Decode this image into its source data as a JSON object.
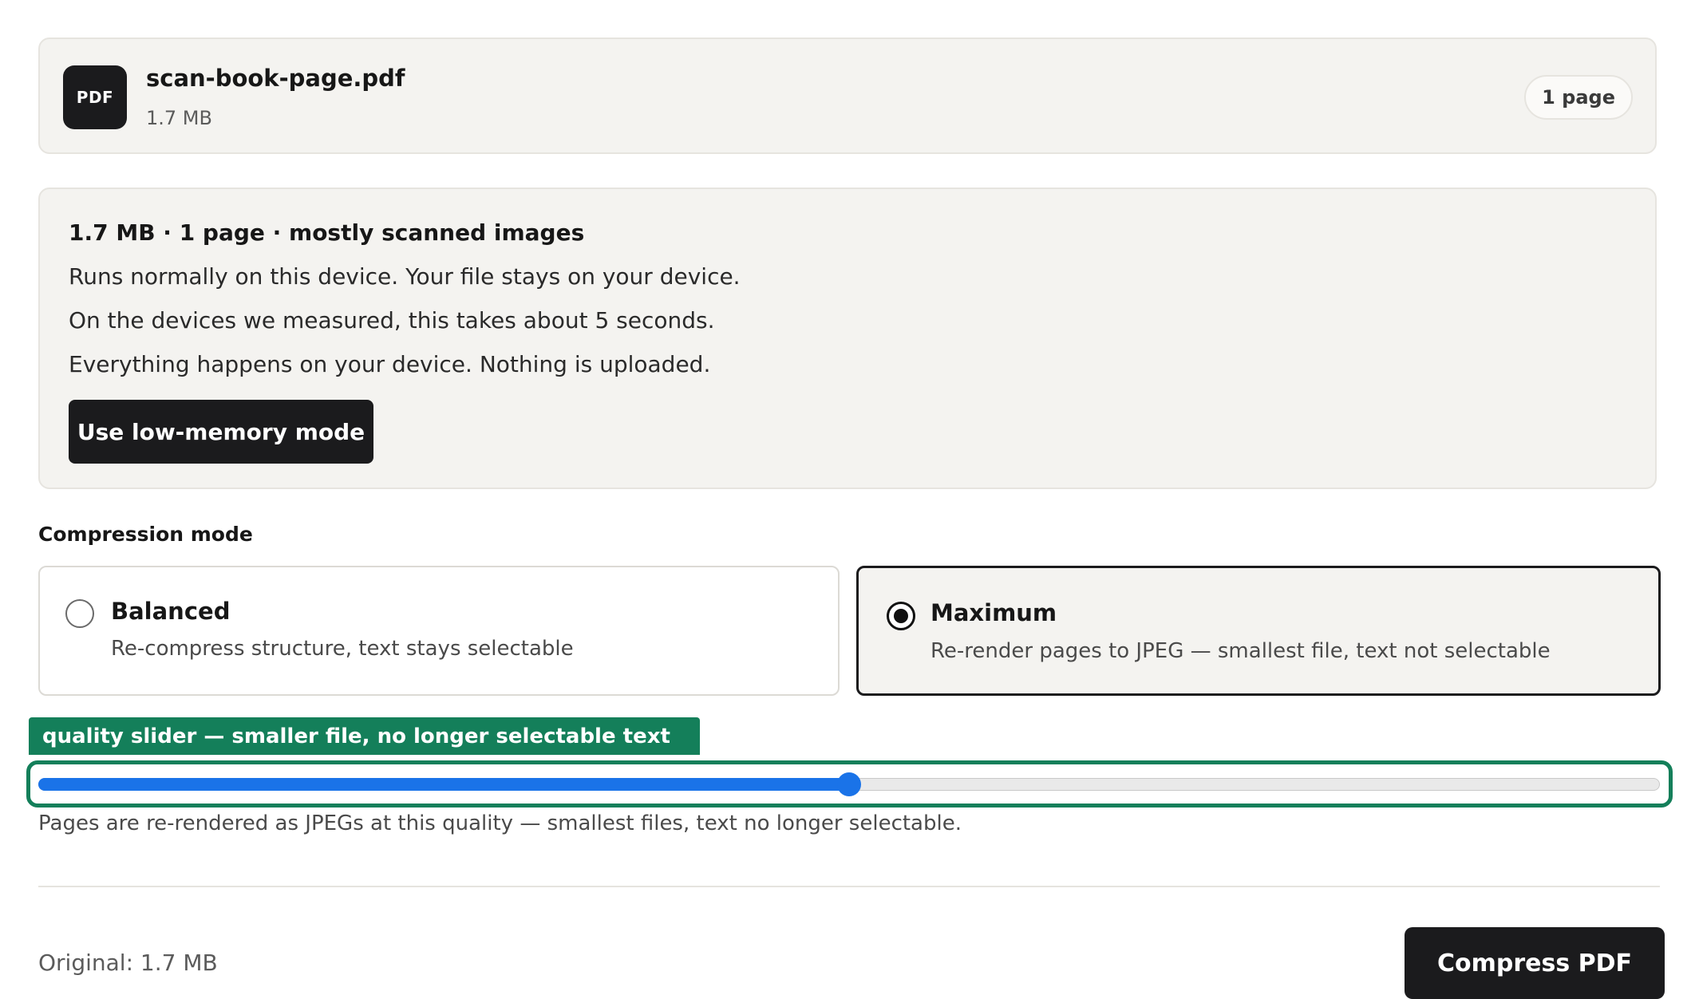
{
  "file": {
    "icon_label": "PDF",
    "name": "scan-book-page.pdf",
    "size": "1.7 MB",
    "pages_badge": "1 page"
  },
  "info": {
    "summary": "1.7 MB · 1 page · mostly scanned images",
    "lines": [
      "Runs normally on this device. Your file stays on your device.",
      "On the devices we measured, this takes about 5 seconds.",
      "Everything happens on your device. Nothing is uploaded."
    ],
    "lowmem_button": "Use low-memory mode"
  },
  "compression": {
    "label": "Compression mode",
    "selected": "maximum",
    "modes": [
      {
        "id": "balanced",
        "title": "Balanced",
        "desc": "Re-compress structure, text stays selectable"
      },
      {
        "id": "maximum",
        "title": "Maximum",
        "desc": "Re-render pages to JPEG — smallest file, text not selectable"
      }
    ]
  },
  "annotation": {
    "label": "quality slider — smaller file, no longer selectable text",
    "color": "#147f5a"
  },
  "quality_slider": {
    "value_fraction": 0.5,
    "help": "Pages are re-rendered as JPEGs at this quality — smallest files, text no longer selectable.",
    "accent": "#1a73e8"
  },
  "footer": {
    "original": "Original: 1.7 MB",
    "compress_button": "Compress PDF"
  }
}
